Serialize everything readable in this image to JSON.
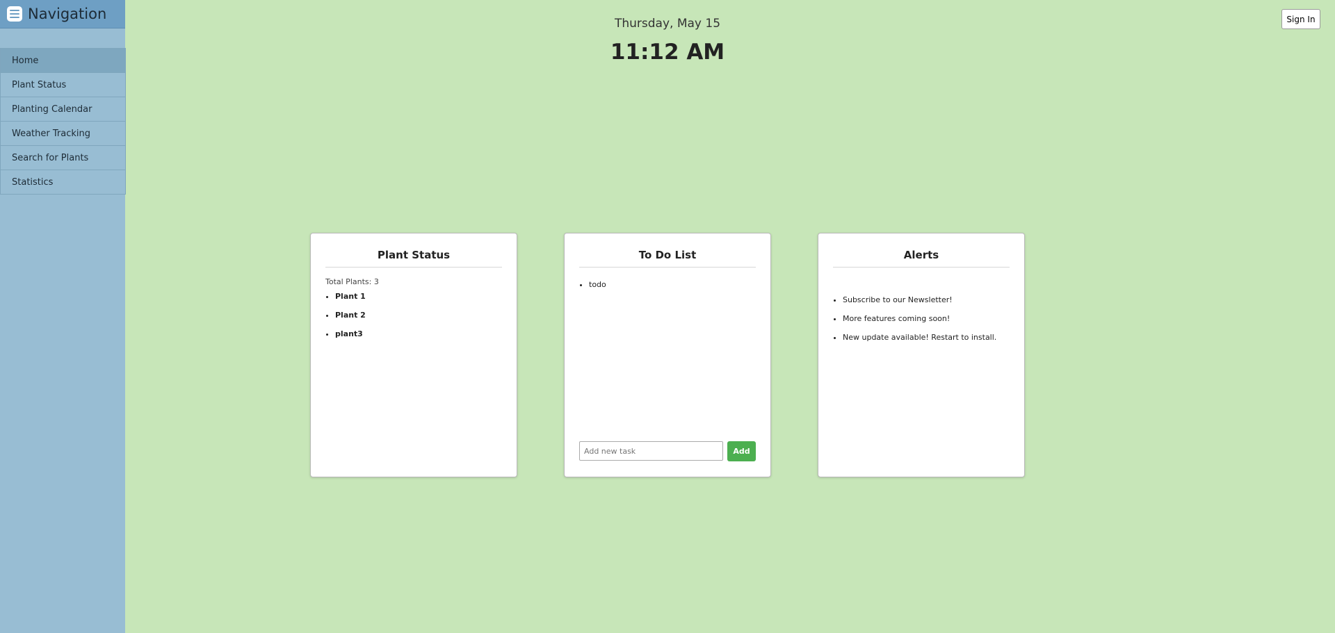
{
  "sidebar": {
    "title": "Navigation",
    "items": [
      {
        "label": "Home"
      },
      {
        "label": "Plant Status"
      },
      {
        "label": "Planting Calendar"
      },
      {
        "label": "Weather Tracking"
      },
      {
        "label": "Search for Plants"
      },
      {
        "label": "Statistics"
      }
    ]
  },
  "header": {
    "date": "Thursday, May 15",
    "time": "11:12 AM",
    "sign_in_label": "Sign In"
  },
  "plant_status": {
    "title": "Plant Status",
    "total_text": "Total Plants: 3",
    "plants": [
      "Plant 1",
      "Plant 2",
      "plant3"
    ]
  },
  "todo": {
    "title": "To Do List",
    "items": [
      "todo"
    ],
    "input_placeholder": "Add new task",
    "add_label": "Add"
  },
  "alerts": {
    "title": "Alerts",
    "items": [
      "Subscribe to our Newsletter!",
      "More features coming soon!",
      "New update available! Restart to install."
    ]
  },
  "colors": {
    "background": "#c7e6b8",
    "sidebar": "#98bdd3",
    "sidebar_header": "#6e9fc4",
    "add_button": "#4caf50"
  }
}
